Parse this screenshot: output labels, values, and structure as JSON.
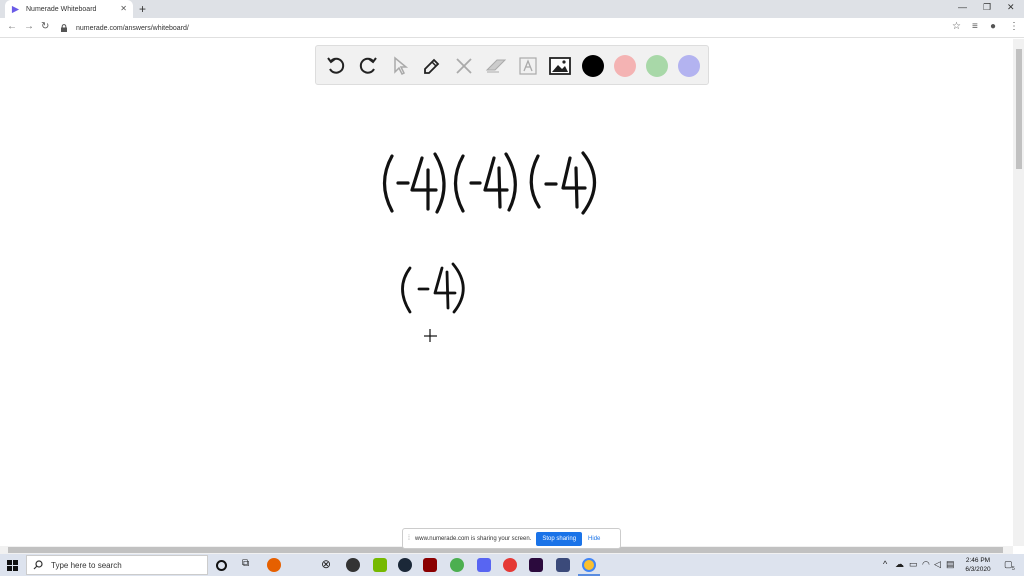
{
  "browser": {
    "tab_title": "Numerade Whiteboard",
    "url": "numerade.com/answers/whiteboard/"
  },
  "whiteboard": {
    "tools": [
      "undo-icon",
      "redo-icon",
      "pointer-icon",
      "pen-icon",
      "tools-icon",
      "eraser-icon",
      "text-icon",
      "image-icon"
    ],
    "colors": [
      "#000000",
      "#f4b3b3",
      "#a8d8a8",
      "#b3b3f0"
    ],
    "handwriting_line1": "(-4)(-4)(-4)",
    "handwriting_line2": "(-4)",
    "cursor": "+"
  },
  "share_bar": {
    "message": "www.numerade.com is sharing your screen.",
    "stop_label": "Stop sharing",
    "hide_label": "Hide"
  },
  "taskbar": {
    "search_placeholder": "Type here to search",
    "time": "2:46 PM",
    "date": "6/3/2020",
    "notification_count": "5"
  }
}
